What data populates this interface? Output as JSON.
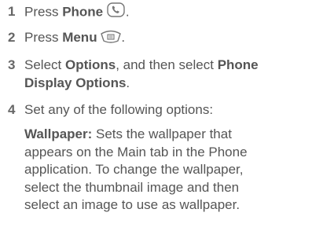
{
  "steps": [
    {
      "number": "1",
      "text_before": "Press ",
      "bold": "Phone",
      "text_after": "",
      "trailing": ".",
      "icon": "phone-handset-icon"
    },
    {
      "number": "2",
      "text_before": "Press ",
      "bold": "Menu",
      "text_after": "",
      "trailing": ".",
      "icon": "menu-key-icon"
    },
    {
      "number": "3",
      "text_before": "Select ",
      "bold": "Options",
      "text_middle": ", and then select ",
      "bold2_line1": "Phone",
      "bold2_line2": "Display Options",
      "trailing": "."
    },
    {
      "number": "4",
      "text": "Set any of the following options:"
    }
  ],
  "option": {
    "label": "Wallpaper:",
    "lines": [
      " Sets the wallpaper that",
      "appears on the Main tab in the Phone",
      "application. To change the wallpaper,",
      "select the thumbnail image and then",
      "select an image to use as wallpaper."
    ]
  },
  "colors": {
    "text": "#555555",
    "number": "#666666"
  }
}
